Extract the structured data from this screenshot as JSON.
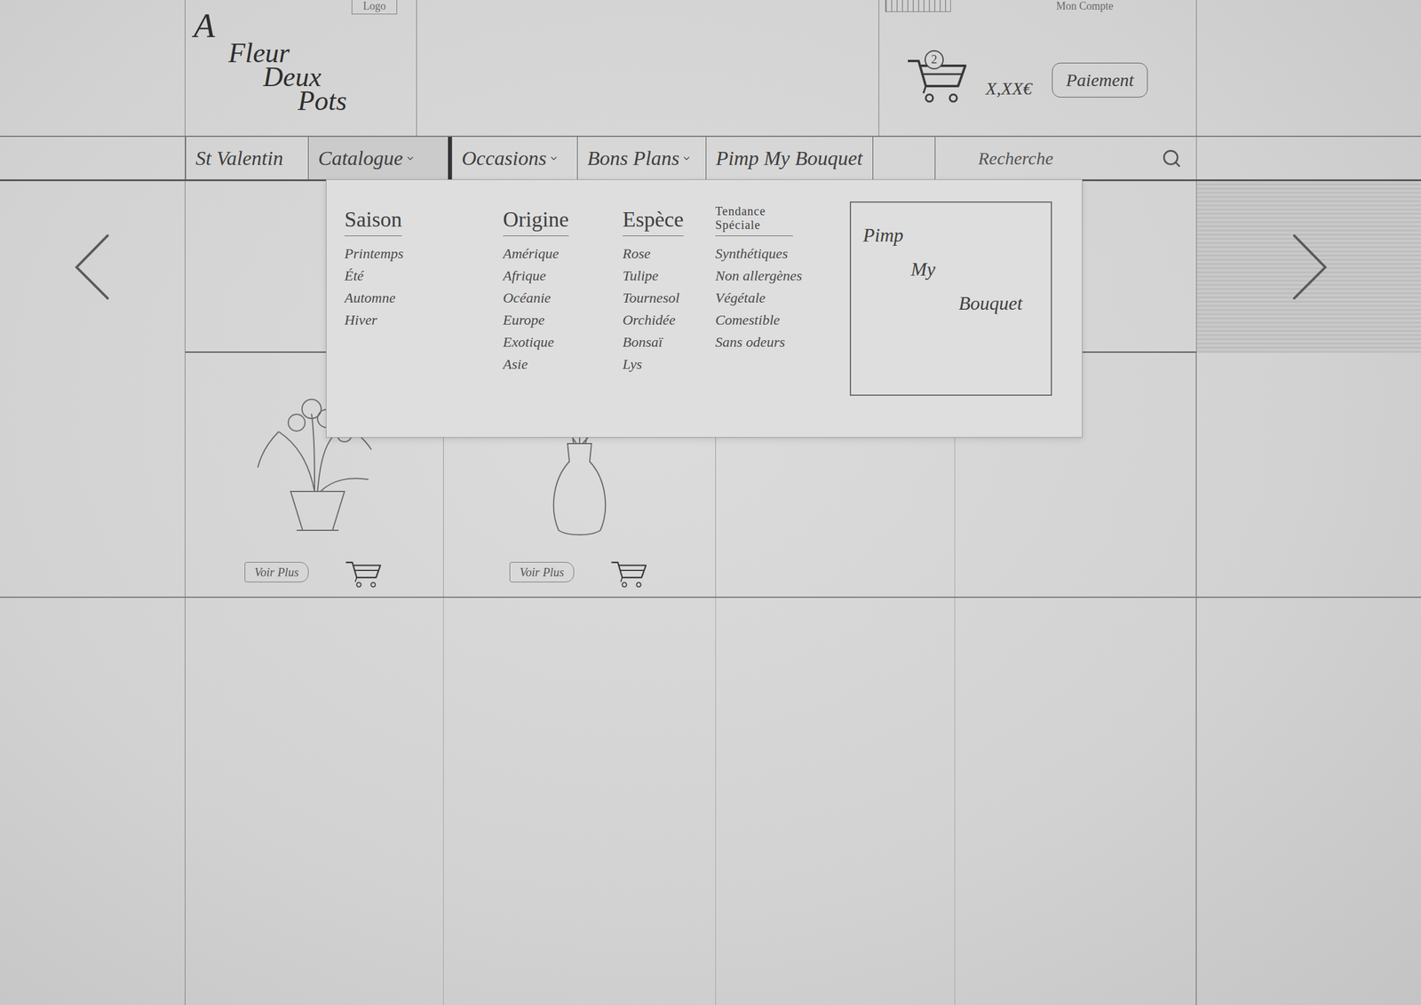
{
  "header": {
    "logo_tag": "Logo",
    "logo_lines": [
      "A",
      "Fleur",
      "Deux",
      "Pots"
    ],
    "account": "Mon Compte",
    "cart_count": "2",
    "cart_total": "X,XX€",
    "pay_button": "Paiement"
  },
  "nav": {
    "items": [
      {
        "label": "St Valentin",
        "dropdown": false,
        "selected": false
      },
      {
        "label": "Catalogue",
        "dropdown": true,
        "selected": true
      },
      {
        "label": "Occasions",
        "dropdown": true,
        "selected": false
      },
      {
        "label": "Bons Plans",
        "dropdown": true,
        "selected": false
      },
      {
        "label": "Pimp My Bouquet",
        "dropdown": false,
        "selected": false
      }
    ],
    "search_placeholder": "Recherche"
  },
  "menu": {
    "open": true,
    "columns": [
      {
        "title": "Saison",
        "items": [
          "Printemps",
          "Été",
          "Automne",
          "Hiver"
        ]
      },
      {
        "title": "Origine",
        "items": [
          "Amérique",
          "Afrique",
          "Océanie",
          "Europe",
          "Exotique",
          "Asie"
        ]
      },
      {
        "title": "Espèce",
        "items": [
          "Rose",
          "Tulipe",
          "Tournesol",
          "Orchidée",
          "Bonsaï",
          "Lys"
        ]
      },
      {
        "title": "Tendance Spéciale",
        "items": [
          "Synthétiques",
          "Non allergènes",
          "Végétale",
          "Comestible",
          "Sans odeurs"
        ]
      }
    ],
    "promo_lines": [
      "Pimp",
      "My",
      "Bouquet"
    ]
  },
  "products": [
    {
      "kind": "pot",
      "button": "Voir Plus"
    },
    {
      "kind": "vase",
      "button": "Voir Plus"
    }
  ]
}
